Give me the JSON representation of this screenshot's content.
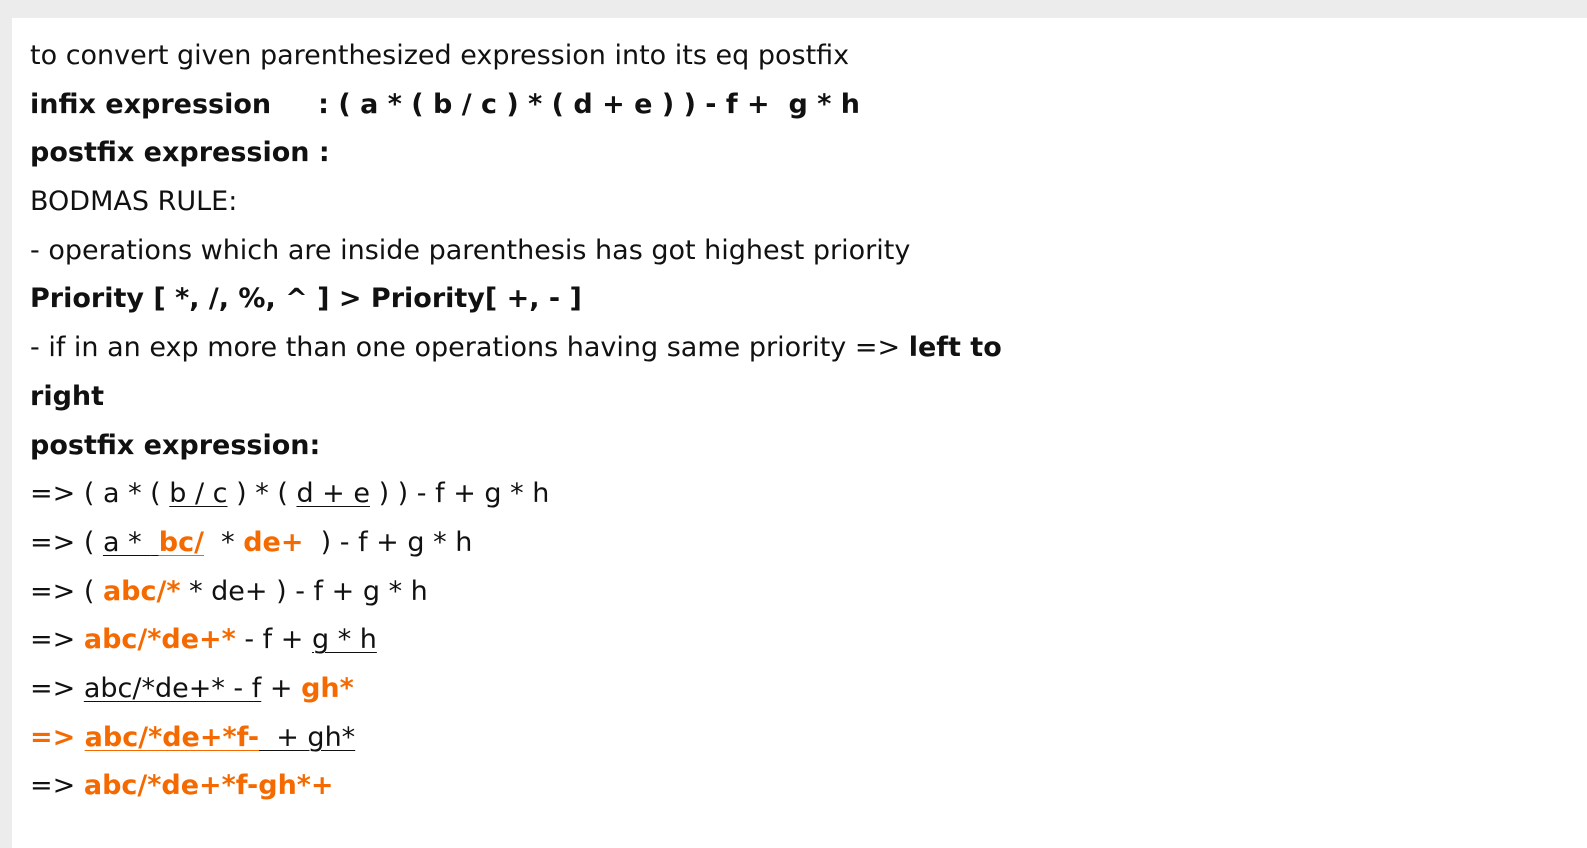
{
  "doc": {
    "accent_color": "#f56a00",
    "lines": {
      "title": "to convert given parenthesized expression into its eq postfix",
      "infix_label": "infix expression",
      "infix_value": "     : ( a * ( b / c ) * ( d + e ) ) - f +  g * h",
      "postfix_label": "postfix expression :",
      "bodmas": "BODMAS RULE:",
      "rule1": "- operations which are inside parenthesis has got highest priority",
      "priority": "Priority [ *, /, %, ^ ] > Priority[ +, - ]",
      "rule2_text": "- if in an exp more than one operations having same priority => ",
      "rule2_bold": "left to",
      "rule2_cont": "right",
      "postfix_heading": "postfix expression:"
    },
    "steps": {
      "s1": {
        "a": "=> ( a * ( ",
        "b": "b / c",
        "c": " ) * ( ",
        "d": "d + e",
        "e": " ) ) - f + g * h"
      },
      "s2": {
        "a": "=> ( ",
        "b": "a * ",
        "c": " ",
        "d": "bc/",
        "e": "  * ",
        "f": "de+",
        "g": "  ) - f + g * h"
      },
      "s3": {
        "a": "=> ( ",
        "b": "abc/*",
        "c": " * de+ ) - f + g * h"
      },
      "s4": {
        "a": "=> ",
        "b": "abc/*de+*",
        "c": " - f + ",
        "d": "g * h"
      },
      "s5": {
        "a": "=> ",
        "b": "abc/*de+* - f",
        "c": " + ",
        "d": "gh*"
      },
      "s6": {
        "a": "=> ",
        "b": "abc/*de+*f-",
        "c": "  + gh*"
      },
      "s7": {
        "a": "=> ",
        "b": "abc/*de+*f-gh*+"
      }
    }
  }
}
